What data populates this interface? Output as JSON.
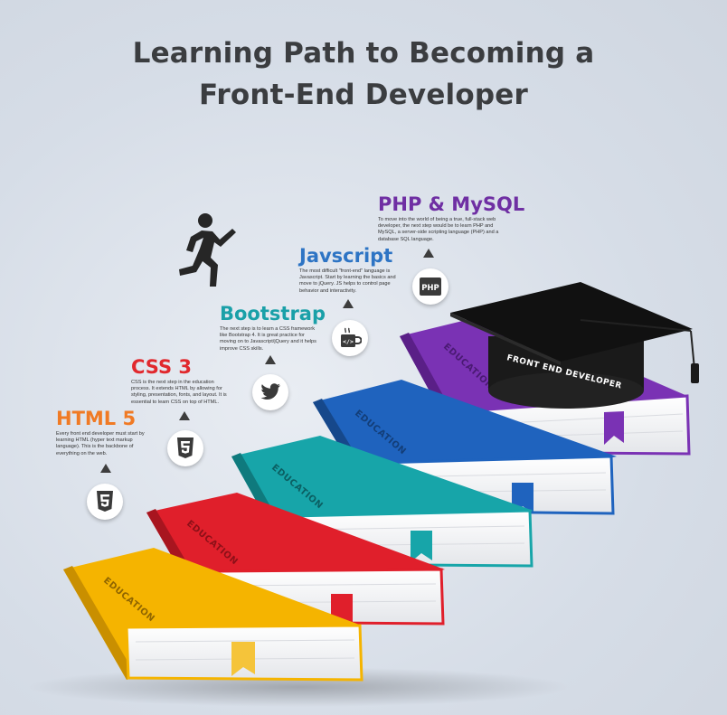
{
  "title": {
    "line1": "Learning Path to Becoming a",
    "line2": "Front-End Developer"
  },
  "steps": [
    {
      "name": "HTML 5",
      "color": "#f07a24",
      "icon": "html5-icon",
      "description": "Every front end developer must start by learning HTML (hyper text markup language). This is the backbone of everything on the web."
    },
    {
      "name": "CSS 3",
      "color": "#e1282d",
      "icon": "css3-icon",
      "description": "CSS is the next step in the education process. It extends HTML by allowing for styling, presentation, fonts, and layout. It is essential to learn CSS on top of HTML."
    },
    {
      "name": "Bootstrap",
      "color": "#1aa0a8",
      "icon": "twitter-icon",
      "description": "The next step is to learn a CSS framework like Bootstrap 4. It is great practice for moving on to Javascript/jQuery and it helps improve CSS skills."
    },
    {
      "name": "Javscript",
      "color": "#2d74c4",
      "icon": "javascript-coffee-icon",
      "description": "The most difficult \"front-end\" language is Javascript. Start by learning the basics and move to jQuery. JS helps to control page behavior and interactivity."
    },
    {
      "name": "PHP & MySQL",
      "color": "#6f2fa3",
      "icon": "php-icon",
      "description": "To move into the world of being a true, full-stack web developer, the next step would be to learn PHP and MySQL, a server-side scripting language (PHP) and a database SQL language."
    }
  ],
  "icons": {
    "php_text": "PHP",
    "js_text": "</>"
  },
  "books": {
    "spine_label": "EDUCATION",
    "colors": [
      "#f5b400",
      "#e01f2b",
      "#17a5a9",
      "#1f63be",
      "#7a32b4"
    ],
    "bookmark_colors": [
      "#f5b400",
      "#e01f2b",
      "#17a5a9",
      "#1f63be",
      "#7a32b4"
    ]
  },
  "cap": {
    "label": "FRONT END DEVELOPER"
  }
}
